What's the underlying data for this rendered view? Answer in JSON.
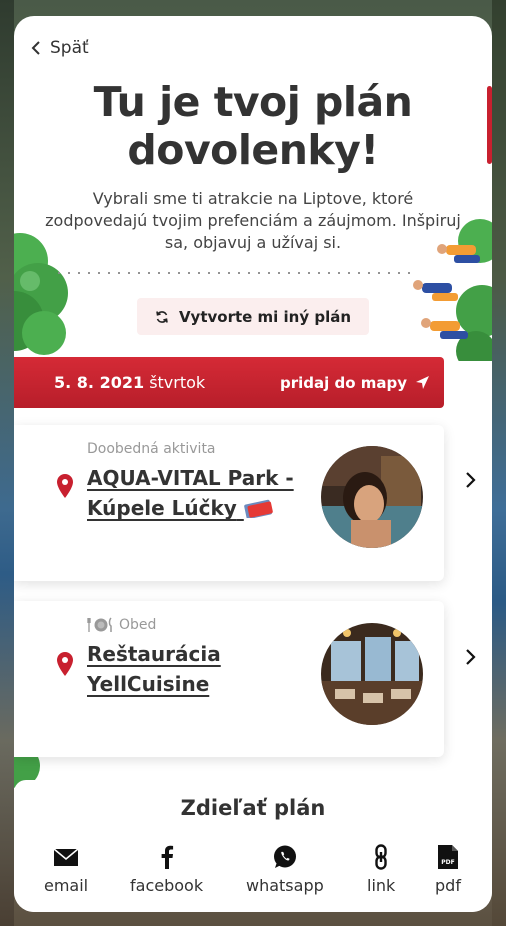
{
  "back_label": "Späť",
  "title_line1": "Tu je tvoj plán",
  "title_line2": "dovolenky!",
  "subtitle": "Vybrali sme ti atrakcie na Liptove, ktoré zodpovedajú tvojim prefenciám a záujmom. Inšpiruj sa, objavuj a užívaj si.",
  "regenerate_label": "Vytvorte mi iný plán",
  "date": {
    "date_bold": "5. 8. 2021",
    "weekday": "štvrtok",
    "add_to_map": "pridaj do mapy"
  },
  "activities": [
    {
      "kind": "Doobedná aktivita",
      "name": "AQUA-VITAL Park - Kúpele Lúčky",
      "icon": "location-pin-icon"
    },
    {
      "kind": "Obed",
      "name": "Reštaurácia YellCuisine",
      "icon": "location-pin-icon"
    }
  ],
  "share": {
    "title": "Zdieľať plán",
    "items": [
      "email",
      "facebook",
      "whatsapp",
      "link",
      "pdf"
    ]
  },
  "colors": {
    "accent": "#c8202f",
    "text": "#333333",
    "muted": "#999999",
    "button_bg": "#fbeeee"
  }
}
